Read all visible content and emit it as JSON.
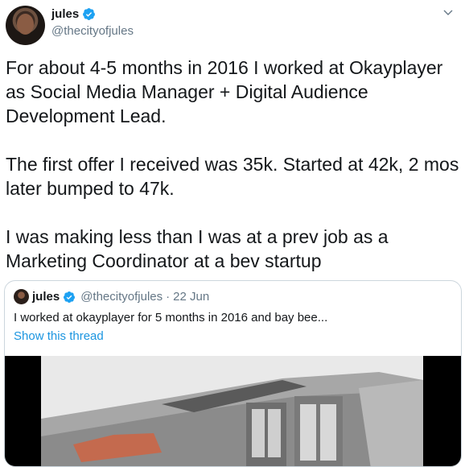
{
  "author": {
    "name": "jules",
    "handle": "@thecityofjules"
  },
  "tweet": {
    "text": "For about 4-5 months in 2016 I worked at Okayplayer as Social Media Manager + Digital Audience Development Lead.\n\nThe first offer I received was 35k. Started at 42k, 2 mos later bumped to 47k.\n\nI was making less than I was at a prev job as a Marketing Coordinator at a bev startup"
  },
  "quoted": {
    "name": "jules",
    "handle": "@thecityofjules",
    "separator": "·",
    "date": "22 Jun",
    "text": "I worked at okayplayer for 5 months in 2016 and bay bee...",
    "show_thread": "Show this thread"
  },
  "icons": {
    "verified": "verified-badge-icon",
    "menu": "chevron-down-icon"
  },
  "colors": {
    "link": "#1b95e0",
    "verified": "#1da1f2",
    "muted": "#657786"
  }
}
